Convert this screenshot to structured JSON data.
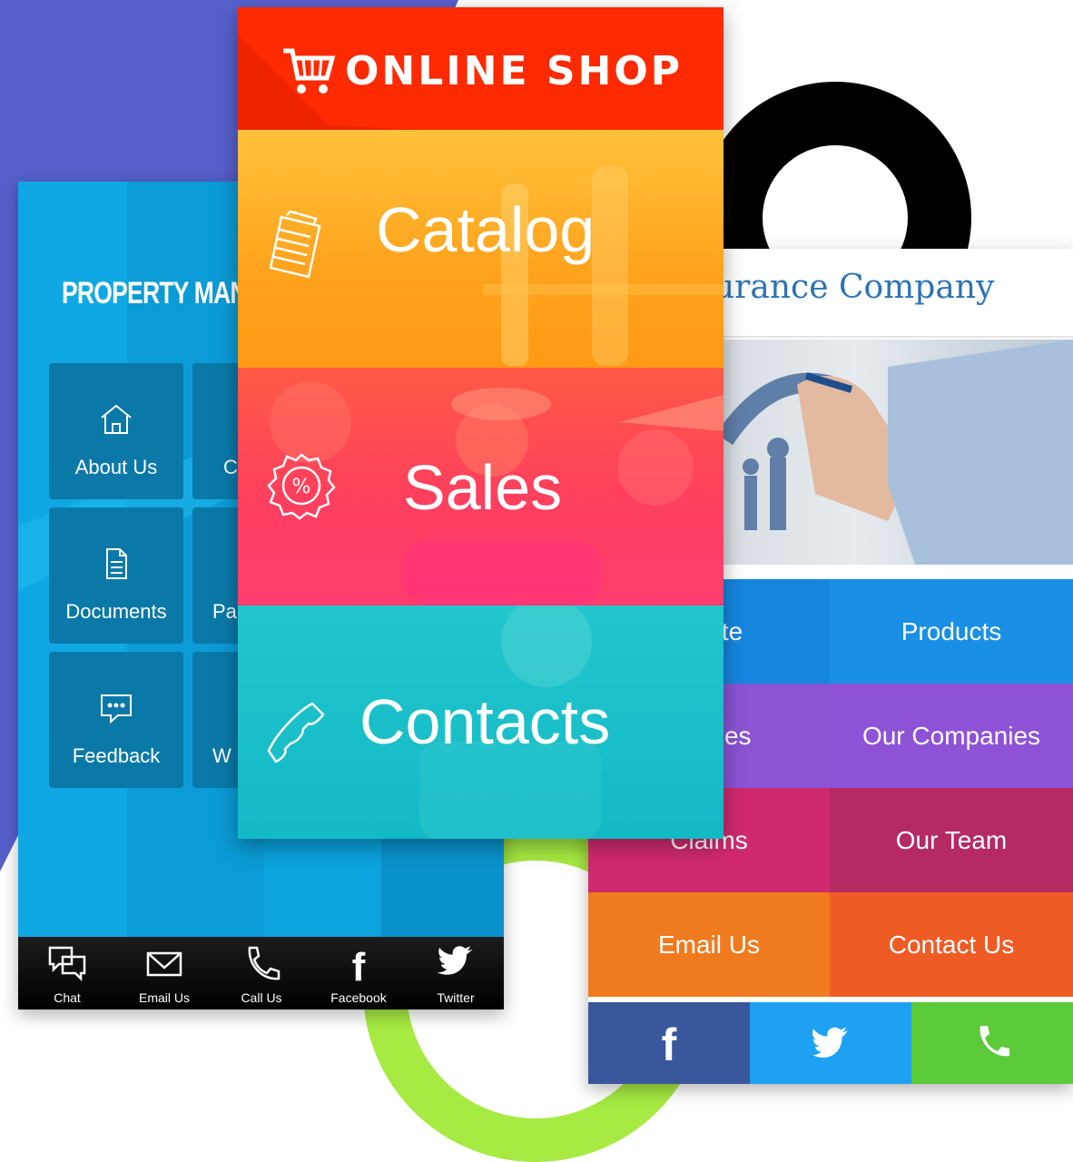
{
  "colors": {
    "purple_bg": "#5660cc",
    "ring_black": "#000000",
    "ring_green": "#a6ea42",
    "pm_blue": "#0aa0dc",
    "pm_tile": "#0a79a8",
    "shop_red": "#ff2a00",
    "shop_orange": "#ffa21c",
    "shop_pink": "#ff4560",
    "shop_teal": "#17c0c8",
    "ins_title": "#2b73b7"
  },
  "property_app": {
    "title": "PROPERTY MANA",
    "tiles": [
      {
        "label": "About Us",
        "icon": "home-icon"
      },
      {
        "label": "Documents",
        "icon": "document-icon"
      },
      {
        "label": "Feedback",
        "icon": "chat-bubble-icon"
      }
    ],
    "partial_tiles": [
      {
        "label": "C"
      },
      {
        "label": "Pa"
      },
      {
        "label": "W"
      }
    ],
    "bottom_bar": [
      {
        "label": "Chat",
        "icon": "chat-icon"
      },
      {
        "label": "Email Us",
        "icon": "envelope-icon"
      },
      {
        "label": "Call Us",
        "icon": "phone-icon"
      },
      {
        "label": "Facebook",
        "icon": "facebook-icon"
      },
      {
        "label": "Twitter",
        "icon": "twitter-icon"
      }
    ]
  },
  "shop_app": {
    "title": "ONLINE SHOP",
    "sections": [
      {
        "label": "Catalog",
        "icon": "notepad-icon"
      },
      {
        "label": "Sales",
        "icon": "percent-badge-icon"
      },
      {
        "label": "Contacts",
        "icon": "phone-handset-icon"
      }
    ]
  },
  "insurance_app": {
    "title": "urance Company",
    "grid": [
      {
        "label": "uote"
      },
      {
        "label": "Products"
      },
      {
        "label": "rvices"
      },
      {
        "label": "Our Companies"
      },
      {
        "label": "Claims"
      },
      {
        "label": "Our Team"
      },
      {
        "label": "Email Us"
      },
      {
        "label": "Contact Us"
      }
    ],
    "social": [
      {
        "icon": "facebook-icon"
      },
      {
        "icon": "twitter-icon"
      },
      {
        "icon": "phone-icon"
      }
    ]
  }
}
